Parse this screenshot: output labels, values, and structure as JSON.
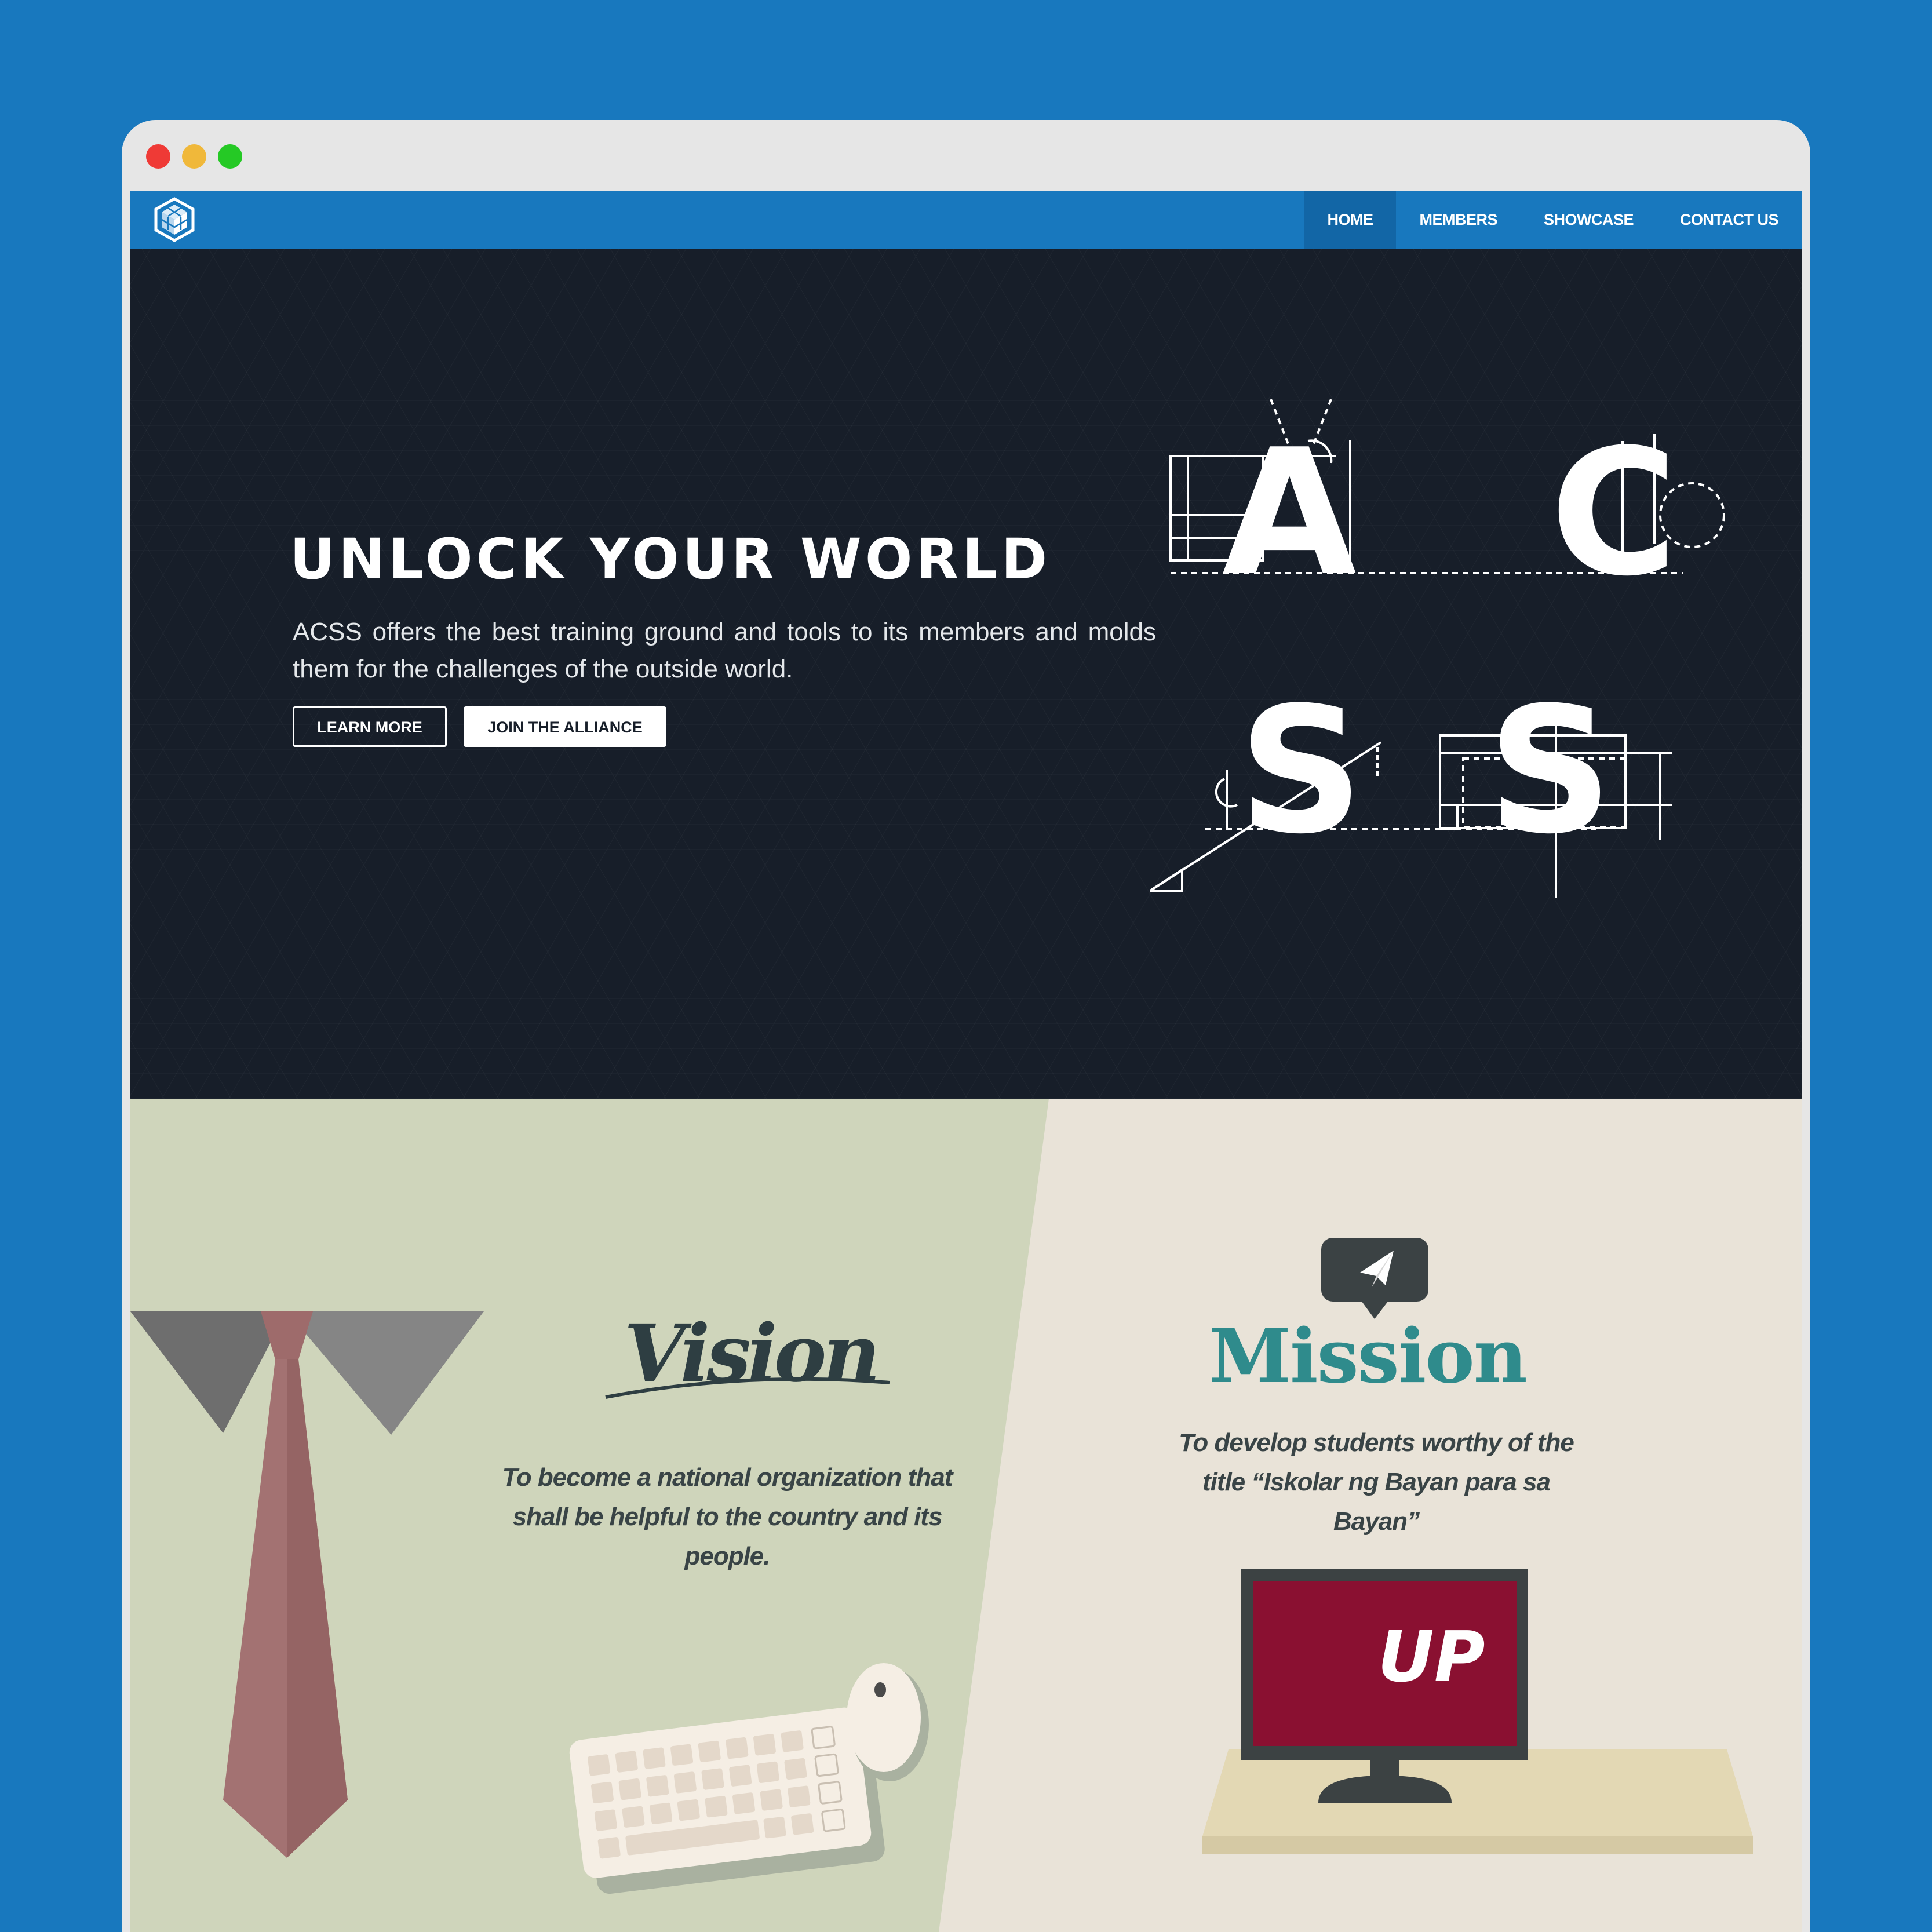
{
  "window": {
    "controls": [
      "close",
      "minimize",
      "maximize"
    ],
    "colors": {
      "close": "#ef3a36",
      "minimize": "#f0b83a",
      "maximize": "#25c925"
    }
  },
  "nav": {
    "logo_icon": "acss-cube-logo-icon",
    "items": [
      {
        "label": "HOME",
        "active": true
      },
      {
        "label": "MEMBERS",
        "active": false
      },
      {
        "label": "SHOWCASE",
        "active": false
      },
      {
        "label": "CONTACT US",
        "active": false
      }
    ],
    "colors": {
      "bar": "#1878be",
      "active": "#1266a6"
    }
  },
  "hero": {
    "title": "UNLOCK YOUR WORLD",
    "subtitle": "ACSS offers the best training ground and tools to its members and molds them for the challenges of the outside world.",
    "learn_more": "LEARN MORE",
    "join": "JOIN THE ALLIANCE",
    "art_letters": [
      "A",
      "C",
      "S",
      "S"
    ],
    "background": "#171e29"
  },
  "vision": {
    "title": "Vision",
    "text": "To become a national organization that shall be helpful to the country and its people."
  },
  "mission": {
    "icon": "paper-plane-icon",
    "title": "Mission",
    "text": "To develop students worthy of the title “Iskolar ng Bayan para sa Bayan”",
    "screen_label": "UP"
  },
  "colors": {
    "vision_bg": "#cfd5bb",
    "mission_bg": "#e9e3d8",
    "mission_title": "#2f8b8c",
    "screen": "#8a1031"
  }
}
